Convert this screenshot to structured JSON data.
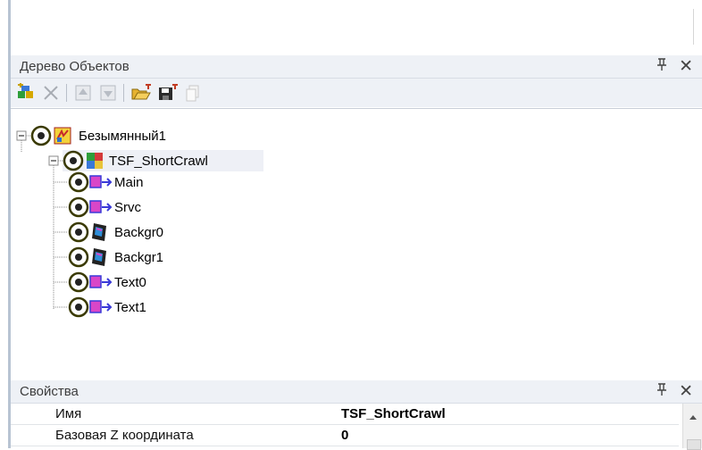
{
  "tree_panel": {
    "title": "Дерево Объектов",
    "pin_glyph": "ᵽ",
    "close_glyph": "✕"
  },
  "toolbar": {
    "icons": [
      "add-object-icon",
      "delete-icon",
      "move-up-icon",
      "move-down-icon",
      "open-folder-icon",
      "save-icon",
      "copy-icon"
    ]
  },
  "tree": {
    "root": "Безымянный1",
    "child": "TSF_ShortCrawl",
    "leaves": [
      "Main",
      "Srvc",
      "Backgr0",
      "Backgr1",
      "Text0",
      "Text1"
    ]
  },
  "props_panel": {
    "title": "Свойства",
    "pin_glyph": "ᵽ",
    "close_glyph": "✕",
    "rows": [
      {
        "name": "Имя",
        "value": "TSF_ShortCrawl"
      },
      {
        "name": "Базовая Z координата",
        "value": "0"
      }
    ]
  },
  "colors": {
    "header_bg": "#eef1f6",
    "selection_bg": "#eef0f6",
    "accent_blue": "#3b6fd6"
  }
}
